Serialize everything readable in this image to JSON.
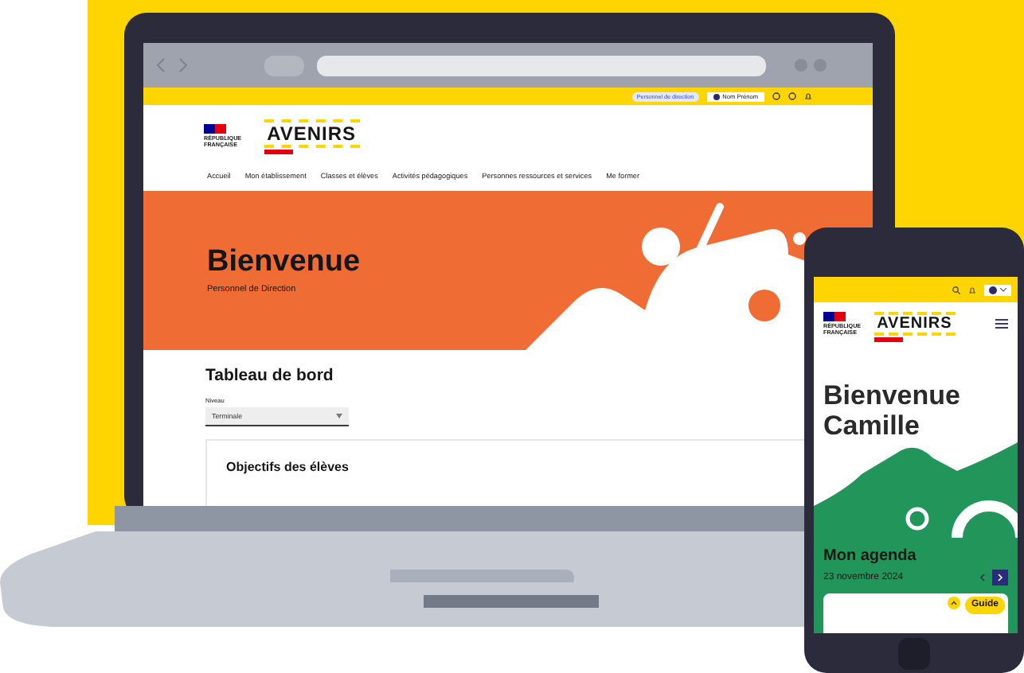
{
  "laptop": {
    "topbar": {
      "role_badge": "Personnel de direction",
      "user": "Nom Prénom"
    },
    "header": {
      "republic_lines": [
        "RÉPUBLIQUE",
        "FRANÇAISE"
      ],
      "brand": "AVENIRS"
    },
    "nav": [
      "Accueil",
      "Mon établissement",
      "Classes et élèves",
      "Activités pédagogiques",
      "Personnes ressources et services",
      "Me former"
    ],
    "hero": {
      "title": "Bienvenue",
      "subtitle": "Personnel de Direction"
    },
    "dashboard": {
      "title": "Tableau de bord",
      "field_label": "Niveau",
      "field_value": "Terminale",
      "card_title": "Objectifs des élèves"
    }
  },
  "phone": {
    "header": {
      "republic_lines": [
        "RÉPUBLIQUE",
        "FRANÇAISE"
      ],
      "brand": "AVENIRS"
    },
    "title_lines": [
      "Bienvenue",
      "Camille"
    ],
    "agenda": {
      "title": "Mon agenda",
      "date": "23 novembre 2024",
      "guide_button": "Guide"
    }
  }
}
